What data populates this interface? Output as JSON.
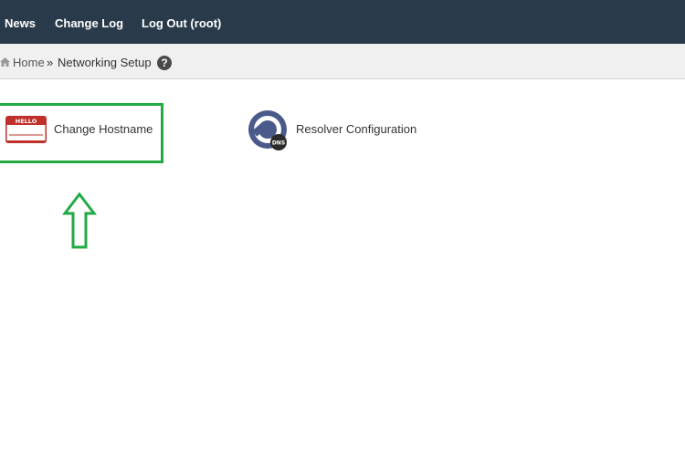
{
  "nav": {
    "items": [
      "News",
      "Change Log",
      "Log Out (root)"
    ]
  },
  "breadcrumb": {
    "home": "Home",
    "separator": "»",
    "current": "Networking Setup",
    "help_glyph": "?"
  },
  "content": {
    "items": [
      {
        "label": "Change Hostname",
        "icon": "hello-name-tag-icon",
        "icon_text": "HELLO"
      },
      {
        "label": "Resolver Configuration",
        "icon": "dns-wrench-icon",
        "icon_text": "DNS"
      }
    ]
  },
  "annotation": {
    "highlight_color": "#22aa44",
    "arrow_color": "#22aa44"
  },
  "colors": {
    "topbar": "#293a4a",
    "breadcrumb_bg": "#f0f0f0"
  }
}
